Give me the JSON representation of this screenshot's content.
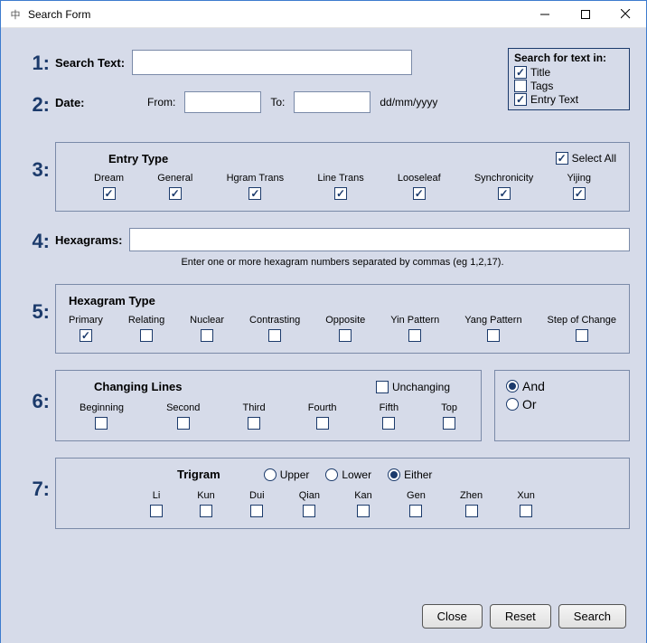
{
  "window": {
    "title": "Search Form"
  },
  "nums": {
    "n1": "1:",
    "n2": "2:",
    "n3": "3:",
    "n4": "4:",
    "n5": "5:",
    "n6": "6:",
    "n7": "7:"
  },
  "section1": {
    "label": "Search Text:",
    "value": "",
    "searchIn": {
      "header": "Search for text in:",
      "title": "Title",
      "tags": "Tags",
      "entry": "Entry Text"
    }
  },
  "section2": {
    "label": "Date:",
    "from": "From:",
    "to": "To:",
    "fmt": "dd/mm/yyyy",
    "fromVal": "",
    "toVal": ""
  },
  "section3": {
    "title": "Entry Type",
    "selectAll": "Select All",
    "items": [
      "Dream",
      "General",
      "Hgram Trans",
      "Line Trans",
      "Looseleaf",
      "Synchronicity",
      "Yijing"
    ]
  },
  "section4": {
    "label": "Hexagrams:",
    "value": "",
    "hint": "Enter one or more hexagram numbers separated by commas (eg 1,2,17)."
  },
  "section5": {
    "title": "Hexagram Type",
    "items": [
      "Primary",
      "Relating",
      "Nuclear",
      "Contrasting",
      "Opposite",
      "Yin Pattern",
      "Yang Pattern",
      "Step of Change"
    ]
  },
  "section6": {
    "title": "Changing Lines",
    "unchanging": "Unchanging",
    "items": [
      "Beginning",
      "Second",
      "Third",
      "Fourth",
      "Fifth",
      "Top"
    ],
    "logic": {
      "and": "And",
      "or": "Or"
    }
  },
  "section7": {
    "title": "Trigram",
    "pos": {
      "upper": "Upper",
      "lower": "Lower",
      "either": "Either"
    },
    "items": [
      "Li",
      "Kun",
      "Dui",
      "Qian",
      "Kan",
      "Gen",
      "Zhen",
      "Xun"
    ]
  },
  "buttons": {
    "close": "Close",
    "reset": "Reset",
    "search": "Search"
  }
}
